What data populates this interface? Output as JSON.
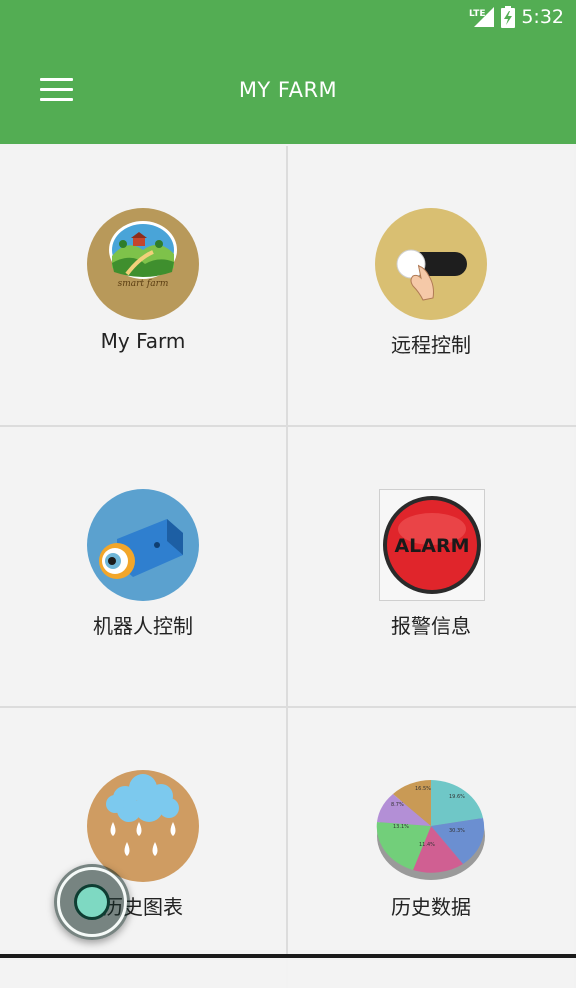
{
  "status_bar": {
    "network": "LTE",
    "time": "5:32"
  },
  "header": {
    "title": "MY FARM",
    "menu_icon": "hamburger-menu-icon"
  },
  "tiles": [
    {
      "label": "My Farm",
      "icon": "smart-farm-logo",
      "icon_text": "smart farm"
    },
    {
      "label": "远程控制",
      "icon": "toggle-switch-icon"
    },
    {
      "label": "机器人控制",
      "icon": "robot-camera-icon"
    },
    {
      "label": "报警信息",
      "icon": "alarm-button-icon",
      "icon_text": "ALARM"
    },
    {
      "label": "历史图表",
      "icon": "rain-cloud-icon"
    },
    {
      "label": "历史数据",
      "icon": "pie-chart-icon",
      "pie_values": [
        "16.5%",
        "19.6%",
        "30.3%",
        "11.4%",
        "13.1%",
        "8.7%"
      ]
    }
  ],
  "colors": {
    "app_bar": "#53ad53",
    "background": "#f2f2f2",
    "alarm_red": "#e0252b"
  }
}
